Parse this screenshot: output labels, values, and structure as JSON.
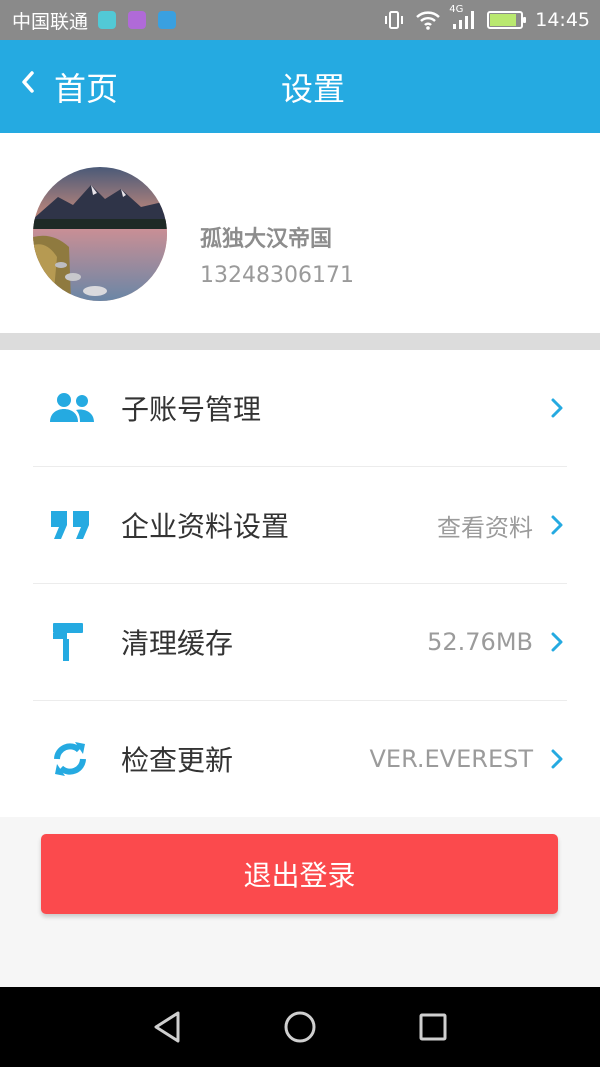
{
  "status_bar": {
    "carrier": "中国联通",
    "network": "4G",
    "time": "14:45",
    "app_icon_colors": [
      "#52c9d6",
      "#b06ad8",
      "#3aa0e0"
    ]
  },
  "header": {
    "back_label": "首页",
    "title": "设置",
    "accent_color": "#25aae1"
  },
  "profile": {
    "name": "孤独大汉帝国",
    "phone": "13248306171"
  },
  "menu": {
    "items": [
      {
        "icon": "people-icon",
        "label": "子账号管理",
        "value": ""
      },
      {
        "icon": "quote-icon",
        "label": "企业资料设置",
        "value": "查看资料"
      },
      {
        "icon": "paint-roller-icon",
        "label": "清理缓存",
        "value": "52.76MB"
      },
      {
        "icon": "refresh-icon",
        "label": "检查更新",
        "value": "VER.EVEREST"
      }
    ]
  },
  "logout": {
    "label": "退出登录",
    "color": "#fb4a4d"
  }
}
